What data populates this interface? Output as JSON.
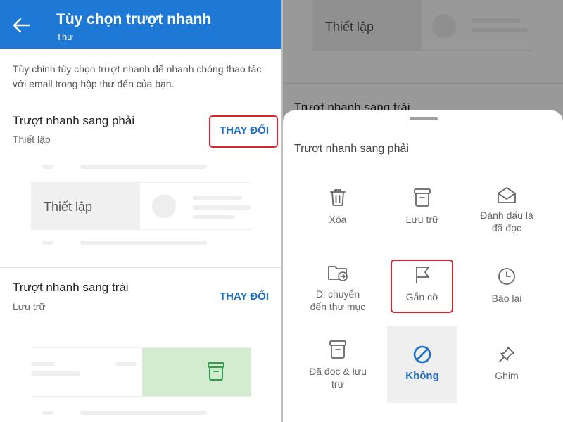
{
  "header": {
    "title": "Tùy chọn trượt nhanh",
    "subtitle": "Thư"
  },
  "description": "Tùy chỉnh tùy chọn trượt nhanh để nhanh chóng thao tác với email trong hộp thư đến của bạn.",
  "swipe_right": {
    "title": "Trượt nhanh sang phải",
    "value": "Thiết lập",
    "change_label": "THAY ĐỔI",
    "preview_label": "Thiết lập"
  },
  "swipe_left": {
    "title": "Trượt nhanh sang trái",
    "value": "Lưu trữ",
    "change_label": "THAY ĐỔI"
  },
  "right_bg": {
    "preview_label": "Thiết lập",
    "section_title": "Trượt nhanh sang trái"
  },
  "sheet": {
    "title": "Trượt nhanh sang phải",
    "options": {
      "delete": "Xóa",
      "archive": "Lưu trữ",
      "mark_read_1": "Đánh dấu là",
      "mark_read_2": "đã đọc",
      "move_1": "Di chuyển",
      "move_2": "đến thư mục",
      "flag": "Gắn cờ",
      "snooze": "Báo lại",
      "read_archive_1": "Đã đọc & lưu",
      "read_archive_2": "trữ",
      "none": "Không",
      "pin": "Ghim"
    }
  },
  "colors": {
    "accent": "#1e78d6",
    "highlight": "#d9262c",
    "archive_green": "#2e9e4a",
    "archive_bg": "#d3ebcf"
  }
}
